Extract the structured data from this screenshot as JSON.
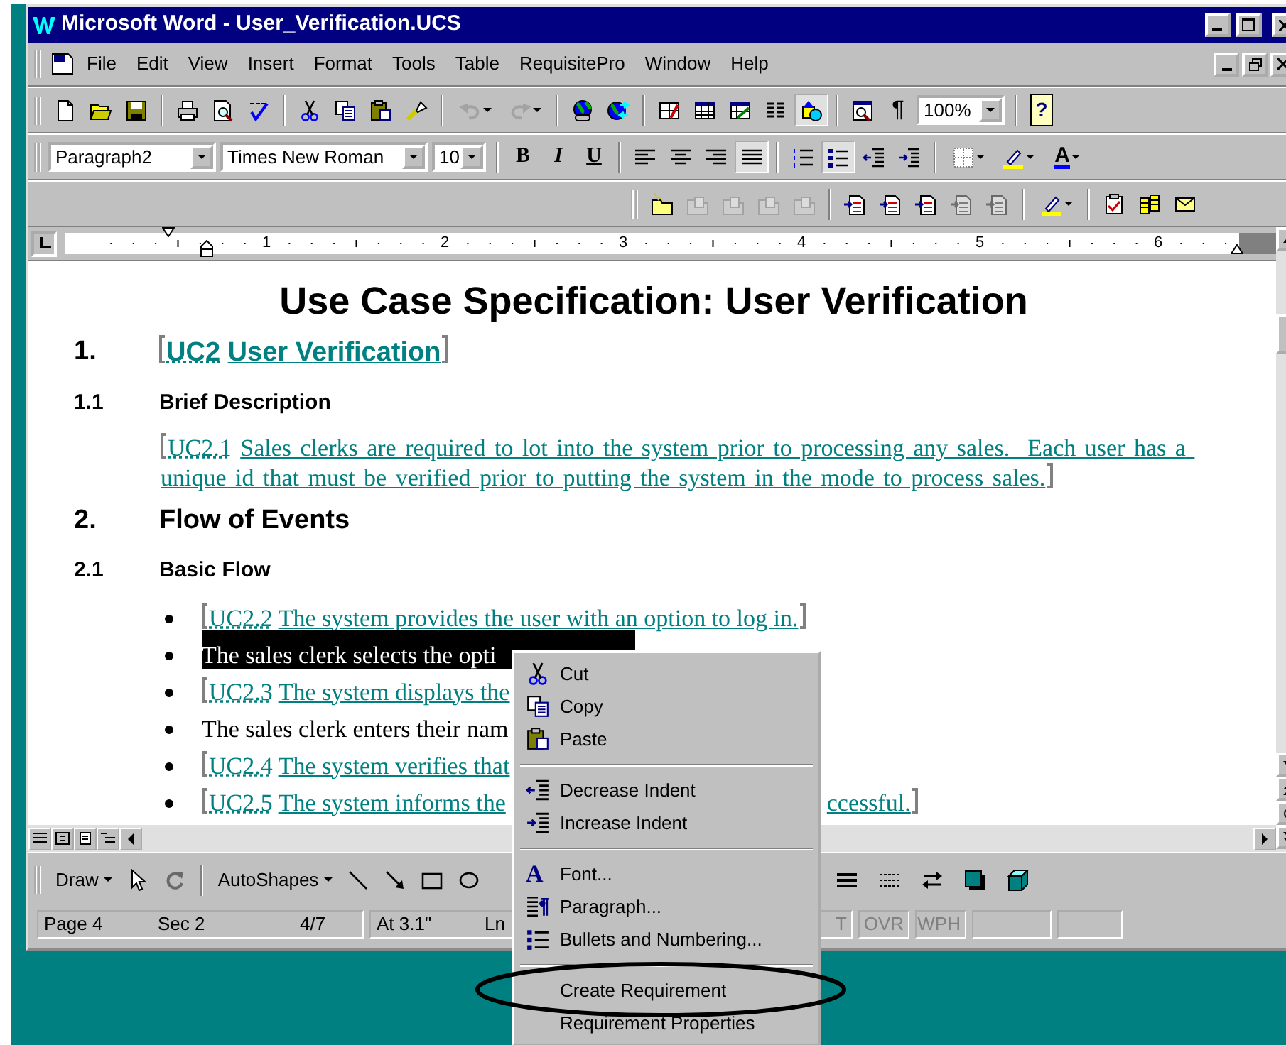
{
  "window": {
    "title": "Microsoft Word - User_Verification.UCS"
  },
  "menu_bar": [
    "File",
    "Edit",
    "View",
    "Insert",
    "Format",
    "Tools",
    "Table",
    "RequisitePro",
    "Window",
    "Help"
  ],
  "standard_toolbar": [
    {
      "kind": "button",
      "pressed": false,
      "disabled": false
    },
    {
      "kind": "button",
      "pressed": false,
      "disabled": false
    },
    {
      "kind": "button",
      "pressed": false,
      "disabled": false
    },
    {
      "kind": "separator"
    },
    {
      "kind": "button",
      "pressed": false,
      "disabled": false
    },
    {
      "kind": "button",
      "pressed": false,
      "disabled": false
    },
    {
      "kind": "button",
      "pressed": false,
      "disabled": false
    },
    {
      "kind": "separator"
    },
    {
      "kind": "button",
      "pressed": false,
      "disabled": false
    },
    {
      "kind": "button",
      "pressed": false,
      "disabled": false
    },
    {
      "kind": "button",
      "pressed": false,
      "disabled": false
    },
    {
      "kind": "button",
      "pressed": false,
      "disabled": false
    },
    {
      "kind": "separator"
    },
    {
      "kind": "split",
      "pressed": false,
      "disabled": true
    },
    {
      "kind": "split",
      "pressed": false,
      "disabled": true
    },
    {
      "kind": "separator"
    },
    {
      "kind": "button",
      "pressed": false,
      "disabled": false
    },
    {
      "kind": "button",
      "pressed": false,
      "disabled": false
    },
    {
      "kind": "separator"
    },
    {
      "kind": "button",
      "pressed": false,
      "disabled": false
    },
    {
      "kind": "button",
      "pressed": false,
      "disabled": false
    },
    {
      "kind": "button",
      "pressed": false,
      "disabled": false
    },
    {
      "kind": "button",
      "pressed": false,
      "disabled": false
    },
    {
      "kind": "button",
      "pressed": true,
      "disabled": false
    },
    {
      "kind": "separator"
    },
    {
      "kind": "button",
      "pressed": false,
      "disabled": false
    },
    {
      "kind": "text",
      "label": "¶",
      "pressed": false,
      "disabled": false
    },
    {
      "kind": "combo",
      "value": "100%"
    },
    {
      "kind": "separator"
    },
    {
      "kind": "text",
      "label": "?",
      "pressed": false,
      "disabled": false
    }
  ],
  "formatting_toolbar": [
    {
      "kind": "combo",
      "value": "Paragraph2"
    },
    {
      "kind": "combo",
      "value": "Times New Roman"
    },
    {
      "kind": "combo",
      "value": "10"
    },
    {
      "kind": "separator"
    },
    {
      "kind": "text",
      "label": "B",
      "pressed": false,
      "disabled": false
    },
    {
      "kind": "text",
      "label": "I",
      "pressed": false,
      "disabled": false
    },
    {
      "kind": "text",
      "label": "U",
      "pressed": false,
      "disabled": false
    },
    {
      "kind": "separator"
    },
    {
      "kind": "button",
      "pressed": false,
      "disabled": false
    },
    {
      "kind": "button",
      "pressed": false,
      "disabled": false
    },
    {
      "kind": "button",
      "pressed": false,
      "disabled": false
    },
    {
      "kind": "button",
      "pressed": true,
      "disabled": false
    },
    {
      "kind": "separator"
    },
    {
      "kind": "button",
      "pressed": false,
      "disabled": false
    },
    {
      "kind": "button",
      "pressed": true,
      "disabled": false
    },
    {
      "kind": "button",
      "pressed": false,
      "disabled": false
    },
    {
      "kind": "button",
      "pressed": false,
      "disabled": false
    },
    {
      "kind": "separator"
    },
    {
      "kind": "split",
      "pressed": false,
      "disabled": false
    },
    {
      "kind": "split",
      "pressed": false,
      "disabled": false
    },
    {
      "kind": "split",
      "label": "A",
      "pressed": false,
      "disabled": false
    }
  ],
  "requisitepro_toolbar": [
    {
      "kind": "button",
      "pressed": false,
      "disabled": false
    },
    {
      "kind": "button",
      "pressed": false,
      "disabled": true
    },
    {
      "kind": "button",
      "pressed": false,
      "disabled": true
    },
    {
      "kind": "button",
      "pressed": false,
      "disabled": true
    },
    {
      "kind": "button",
      "pressed": false,
      "disabled": true
    },
    {
      "kind": "separator"
    },
    {
      "kind": "button",
      "pressed": false,
      "disabled": false
    },
    {
      "kind": "button",
      "pressed": false,
      "disabled": false
    },
    {
      "kind": "button",
      "pressed": false,
      "disabled": false
    },
    {
      "kind": "button",
      "pressed": false,
      "disabled": true
    },
    {
      "kind": "button",
      "pressed": false,
      "disabled": true
    },
    {
      "kind": "separator"
    },
    {
      "kind": "split",
      "pressed": false,
      "disabled": false
    },
    {
      "kind": "separator"
    },
    {
      "kind": "button",
      "pressed": false,
      "disabled": false
    },
    {
      "kind": "button",
      "pressed": false,
      "disabled": false
    },
    {
      "kind": "button",
      "pressed": false,
      "disabled": false
    }
  ],
  "ruler": {
    "labels": [
      "1",
      "2",
      "3",
      "4",
      "5",
      "6"
    ]
  },
  "document": {
    "title": "Use Case Specification: User Verification",
    "blocks": [
      {
        "kind": "heading1",
        "number": "1.",
        "tag": "UC2",
        "text": "User Verification"
      },
      {
        "kind": "heading2",
        "number": "1.1",
        "text": "Brief Description"
      },
      {
        "kind": "requirement",
        "tag": "UC2.1",
        "text": "Sales clerks are required to lot into the system prior to processing any sales.  Each user has a unique id that must be verified prior to putting the system in the mode to process sales."
      },
      {
        "kind": "heading1",
        "number": "2.",
        "text": "Flow of Events"
      },
      {
        "kind": "heading2",
        "number": "2.1",
        "text": "Basic Flow"
      },
      {
        "kind": "bullets",
        "items": [
          {
            "kind": "requirement",
            "tag": "UC2.2",
            "text": "The system provides the user with an option to log in.",
            "closed": true,
            "selected": false
          },
          {
            "kind": "plain",
            "text": "The sales clerk selects the opti",
            "selected": true
          },
          {
            "kind": "requirement",
            "tag": "UC2.3",
            "text": "The system displays the",
            "closed": false,
            "selected": false
          },
          {
            "kind": "plain",
            "text": "The sales clerk enters their nam",
            "selected": false
          },
          {
            "kind": "requirement",
            "tag": "UC2.4",
            "text": "The system verifies that",
            "closed": false,
            "selected": false
          },
          {
            "kind": "requirement",
            "tag": "UC2.5",
            "text": "The system informs the",
            "tail": "ccessful.",
            "closed": true,
            "selected": false
          }
        ]
      }
    ]
  },
  "draw_toolbar": {
    "left": [
      {
        "kind": "menu",
        "label": "Draw"
      },
      {
        "kind": "button",
        "disabled": false
      },
      {
        "kind": "button",
        "disabled": true
      },
      {
        "kind": "separator"
      },
      {
        "kind": "menu",
        "label": "AutoShapes"
      },
      {
        "kind": "button",
        "disabled": false
      },
      {
        "kind": "button",
        "disabled": false
      },
      {
        "kind": "button",
        "disabled": false
      },
      {
        "kind": "button",
        "disabled": false
      }
    ],
    "right": [
      {
        "kind": "button",
        "disabled": false
      },
      {
        "kind": "button",
        "disabled": false
      },
      {
        "kind": "button",
        "disabled": false
      },
      {
        "kind": "button",
        "disabled": false
      },
      {
        "kind": "button",
        "disabled": false
      }
    ]
  },
  "status_bar": {
    "sections": [
      [
        "Page 4",
        "Sec 2",
        "4/7"
      ],
      [
        "At 3.1\"",
        "Ln"
      ]
    ],
    "modes": [
      {
        "label": "T",
        "enabled": false
      },
      {
        "label": "OVR",
        "enabled": false
      },
      {
        "label": "WPH",
        "enabled": false
      }
    ]
  },
  "context_menu": [
    {
      "kind": "item",
      "label": "Cut",
      "circled": false
    },
    {
      "kind": "item",
      "label": "Copy",
      "circled": false
    },
    {
      "kind": "item",
      "label": "Paste",
      "circled": false
    },
    {
      "kind": "separator"
    },
    {
      "kind": "item",
      "label": "Decrease Indent",
      "circled": false
    },
    {
      "kind": "item",
      "label": "Increase Indent",
      "circled": false
    },
    {
      "kind": "separator"
    },
    {
      "kind": "item",
      "label": "Font...",
      "glyph": "A",
      "circled": false
    },
    {
      "kind": "item",
      "label": "Paragraph...",
      "circled": false
    },
    {
      "kind": "item",
      "label": "Bullets and Numbering...",
      "circled": false
    },
    {
      "kind": "separator"
    },
    {
      "kind": "item",
      "label": "Create Requirement",
      "circled": true
    },
    {
      "kind": "item",
      "label": "Requirement Properties",
      "circled": false
    }
  ]
}
